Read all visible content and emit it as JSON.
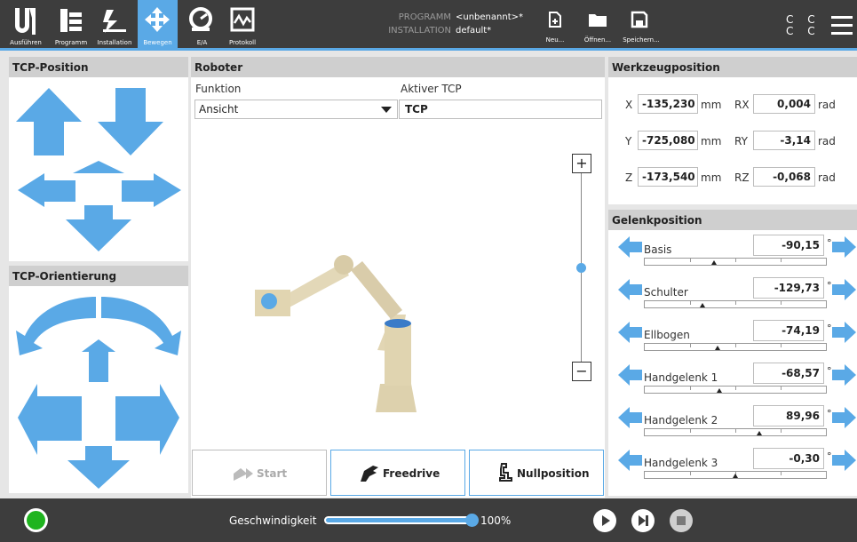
{
  "nav": {
    "run": "Ausführen",
    "program": "Programm",
    "installation": "Installation",
    "move": "Bewegen",
    "io": "E/A",
    "log": "Protokoll"
  },
  "header": {
    "program_label": "PROGRAMM",
    "program_value": "<unbenannt>*",
    "installation_label": "INSTALLATION",
    "installation_value": "default*"
  },
  "file": {
    "new": "Neu...",
    "open": "Öffnen...",
    "save": "Speichern..."
  },
  "cc": "C C\nC C",
  "tcp_position": {
    "title": "TCP-Position"
  },
  "tcp_orientation": {
    "title": "TCP-Orientierung"
  },
  "robot": {
    "title": "Roboter",
    "function_label": "Funktion",
    "function_value": "Ansicht",
    "active_tcp_label": "Aktiver TCP",
    "active_tcp_value": "TCP",
    "zoom_in": "+",
    "zoom_out": "−",
    "zoom_level": 0.5
  },
  "tool": {
    "title": "Werkzeugposition",
    "x_label": "X",
    "x": "-135,230",
    "x_unit": "mm",
    "y_label": "Y",
    "y": "-725,080",
    "y_unit": "mm",
    "z_label": "Z",
    "z": "-173,540",
    "z_unit": "mm",
    "rx_label": "RX",
    "rx": "0,004",
    "rx_unit": "rad",
    "ry_label": "RY",
    "ry": "-3,14",
    "ry_unit": "rad",
    "rz_label": "RZ",
    "rz": "-0,068",
    "rz_unit": "rad"
  },
  "joints": {
    "title": "Gelenkposition",
    "unit": "°",
    "items": [
      {
        "label": "Basis",
        "value": "-90,15",
        "pos": 0.38
      },
      {
        "label": "Schulter",
        "value": "-129,73",
        "pos": 0.32
      },
      {
        "label": "Ellbogen",
        "value": "-74,19",
        "pos": 0.4
      },
      {
        "label": "Handgelenk 1",
        "value": "-68,57",
        "pos": 0.41
      },
      {
        "label": "Handgelenk 2",
        "value": "89,96",
        "pos": 0.63
      },
      {
        "label": "Handgelenk 3",
        "value": "-0,30",
        "pos": 0.5
      }
    ]
  },
  "actions": {
    "start": "Start",
    "freedrive": "Freedrive",
    "home": "Nullposition"
  },
  "speed": {
    "label": "Geschwindigkeit",
    "value": "100%",
    "fraction": 1.0
  },
  "colors": {
    "accent": "#5aa9e6",
    "topbar": "#3d3d3d",
    "status": "#1fb41f"
  }
}
